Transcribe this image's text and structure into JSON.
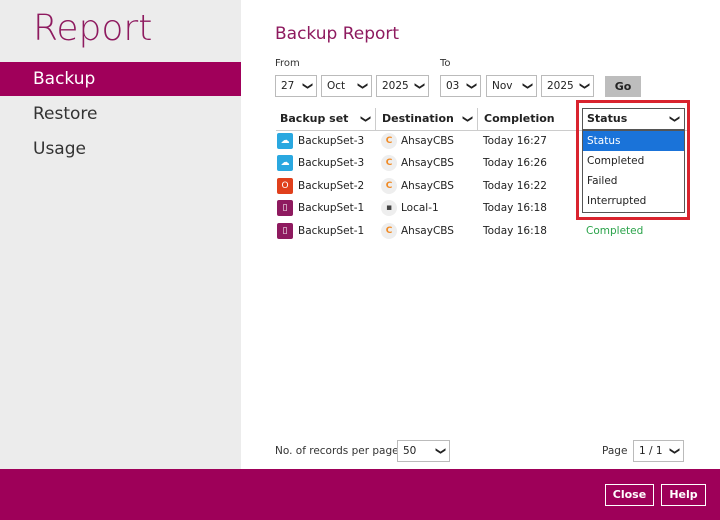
{
  "sidebar": {
    "title": "Report",
    "items": [
      {
        "label": "Backup",
        "active": true
      },
      {
        "label": "Restore"
      },
      {
        "label": "Usage"
      }
    ]
  },
  "main": {
    "title": "Backup Report",
    "from": {
      "label": "From",
      "day": "27",
      "month": "Oct",
      "year": "2025"
    },
    "to": {
      "label": "To",
      "day": "03",
      "month": "Nov",
      "year": "2025"
    },
    "go_label": "Go",
    "columns": [
      "Backup set",
      "Destination",
      "Completion",
      "Status"
    ],
    "rows": [
      {
        "set": "BackupSet-3",
        "set_icon": "cloud-file-icon",
        "dest": "AhsayCBS",
        "dest_icon": "ahsaycbs-icon",
        "time": "Today 16:27",
        "status": ""
      },
      {
        "set": "BackupSet-3",
        "set_icon": "cloud-file-icon",
        "dest": "AhsayCBS",
        "dest_icon": "ahsaycbs-icon",
        "time": "Today 16:26",
        "status": ""
      },
      {
        "set": "BackupSet-2",
        "set_icon": "office365-icon",
        "dest": "AhsayCBS",
        "dest_icon": "ahsaycbs-icon",
        "time": "Today 16:22",
        "status": ""
      },
      {
        "set": "BackupSet-1",
        "set_icon": "file-icon",
        "dest": "Local-1",
        "dest_icon": "local-drive-icon",
        "time": "Today 16:18",
        "status": ""
      },
      {
        "set": "BackupSet-1",
        "set_icon": "file-icon",
        "dest": "AhsayCBS",
        "dest_icon": "ahsaycbs-icon",
        "time": "Today 16:18",
        "status": "Completed"
      }
    ],
    "status_filter": {
      "selected": "Status",
      "options": [
        "Status",
        "Completed",
        "Failed",
        "Interrupted"
      ]
    },
    "records_label": "No. of records per page",
    "records_value": "50",
    "page_label": "Page",
    "page_value": "1 / 1"
  },
  "footer": {
    "close": "Close",
    "help": "Help"
  },
  "colors": {
    "brand": "#9e0059",
    "completed": "#2aa34a",
    "highlight": "#d9232e",
    "selected_option": "#1a73d9"
  }
}
